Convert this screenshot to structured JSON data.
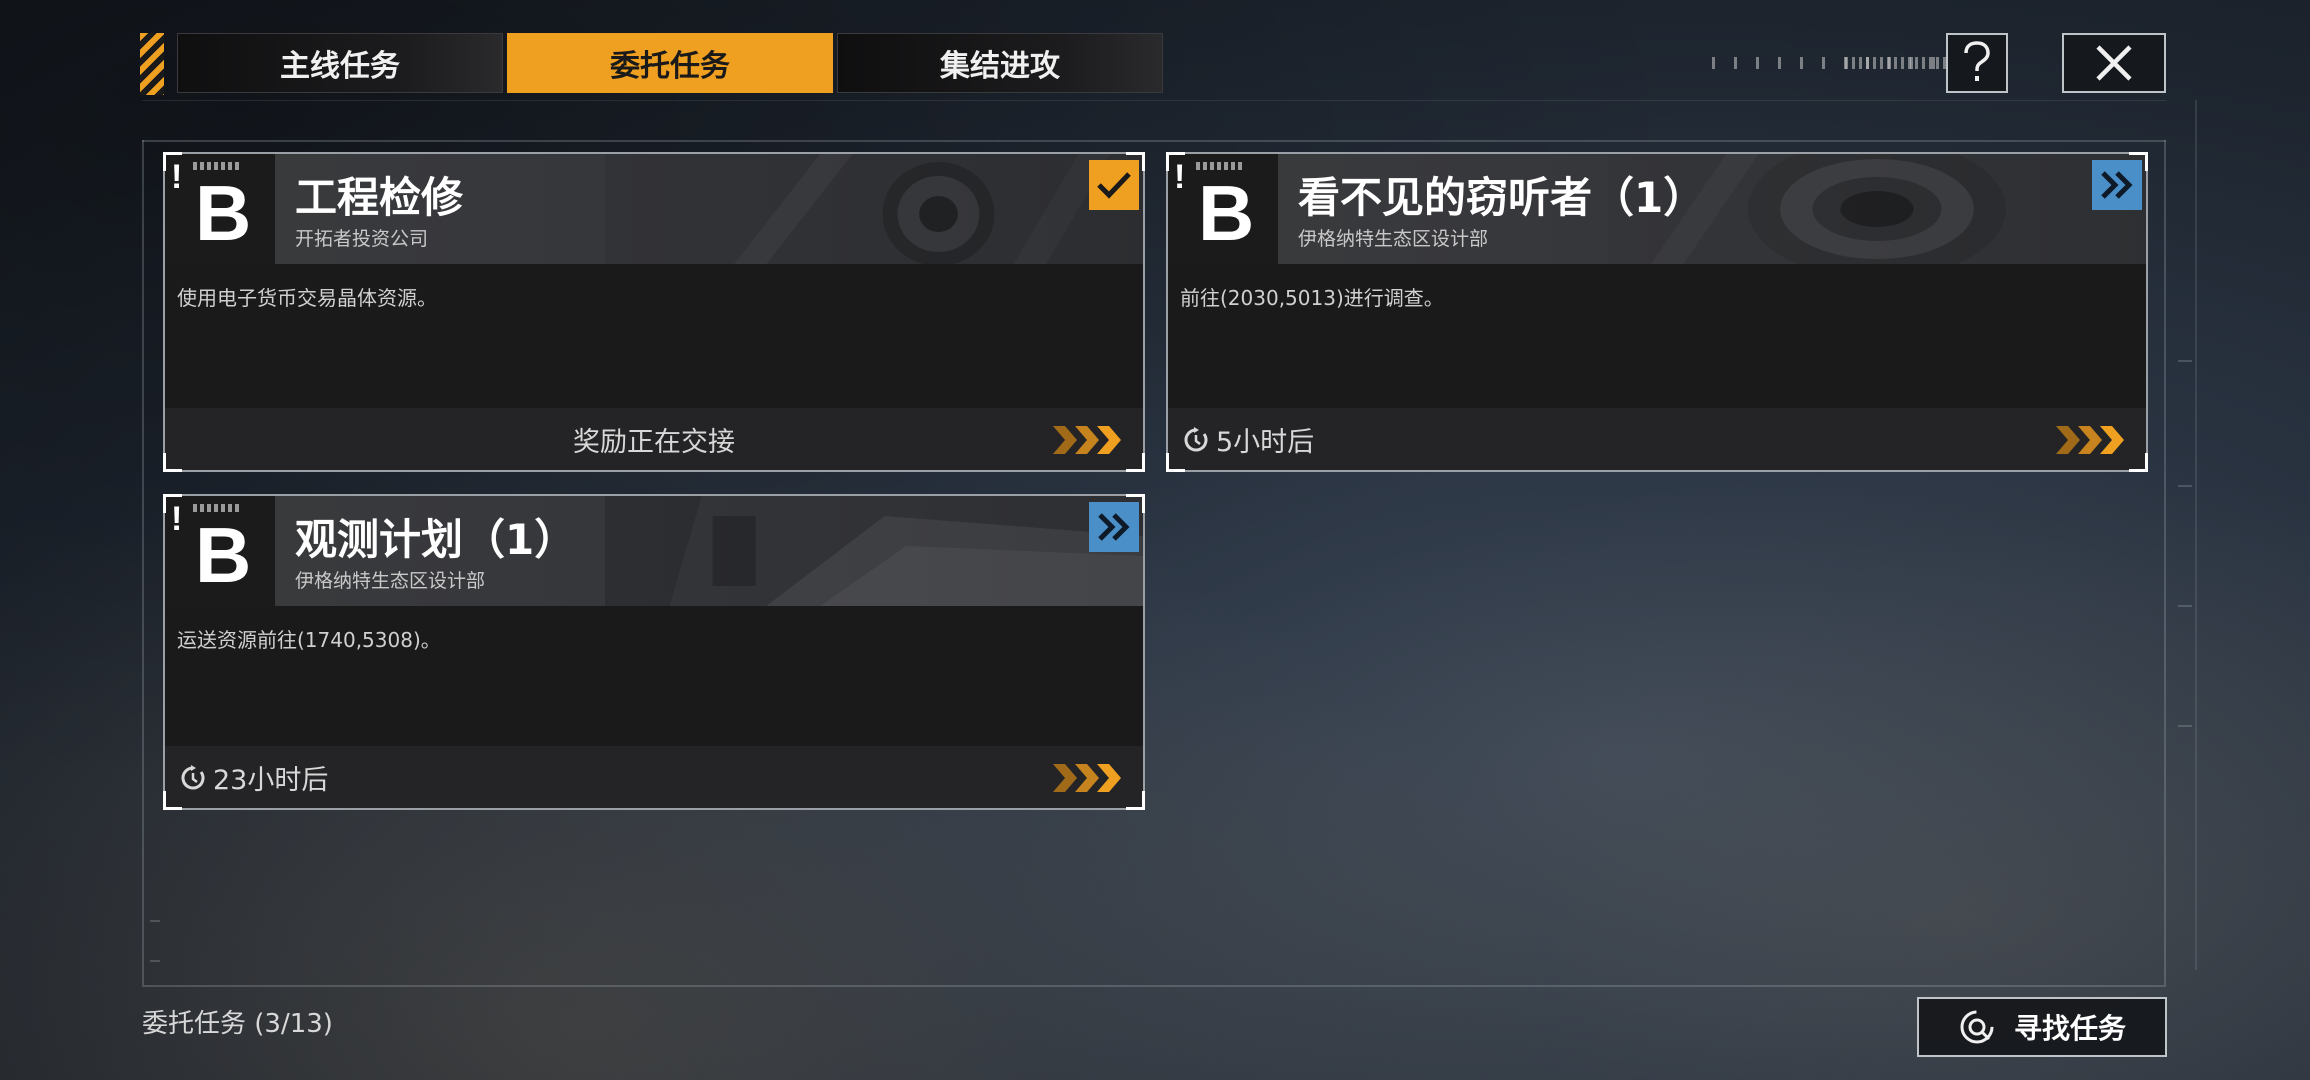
{
  "tabs": [
    {
      "label": "主线任务",
      "active": false
    },
    {
      "label": "委托任务",
      "active": true
    },
    {
      "label": "集结进攻",
      "active": false
    }
  ],
  "header": {
    "help_icon": "question-icon",
    "close_icon": "close-icon"
  },
  "cards": [
    {
      "grade": "B",
      "title": "工程检修",
      "issuer": "开拓者投资公司",
      "description": "使用电子货币交易晶体资源。",
      "status": "奖励正在交接",
      "badge": "checkmark-icon"
    },
    {
      "grade": "B",
      "title": "看不见的窃听者（1）",
      "issuer": "伊格纳特生态区设计部",
      "description": "前往(2030,5013)进行调查。",
      "timer": "5小时后",
      "badge": "double-chevron-icon"
    },
    {
      "grade": "B",
      "title": "观测计划（1）",
      "issuer": "伊格纳特生态区设计部",
      "description": "运送资源前往(1740,5308)。",
      "timer": "23小时后",
      "badge": "double-chevron-icon"
    }
  ],
  "footer": {
    "count_label": "委托任务 (3/13)",
    "find_button": "寻找任务"
  },
  "colors": {
    "accent": "#f0a020",
    "badge_blue": "#4a8fc8"
  }
}
